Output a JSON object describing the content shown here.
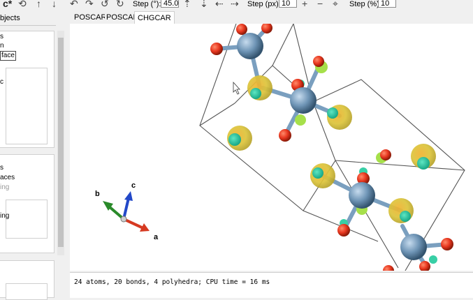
{
  "toolbar": {
    "c_icon": "c*",
    "step_deg_label": "Step (°):",
    "step_deg_value": "45.0",
    "step_px_label": "Step (px):",
    "step_px_value": "10",
    "step_pct_label": "Step (%):",
    "step_pct_value": "10"
  },
  "left_panel": {
    "header": "bjects",
    "items_top": [
      "s",
      "n",
      "face",
      "c"
    ],
    "items_mid": [
      "s",
      "aces",
      "ing"
    ],
    "items_low": [
      "ing"
    ]
  },
  "tabs": [
    "POSCAR",
    "POSCAR",
    "CHGCAR"
  ],
  "active_tab": "CHGCAR",
  "axes": {
    "a": "a",
    "b": "b",
    "c": "c"
  },
  "status": "24 atoms, 20 bonds, 4 polyhedra; CPU time = 16 ms",
  "colors": {
    "oxygen": "#e8371f",
    "metal": "#6f95b6",
    "isosurface_yellow": "#d9c237",
    "isosurface_cyan": "#22c9a0",
    "axis_a": "#d63a22",
    "axis_b": "#2a8a2a",
    "axis_c": "#2248c8"
  }
}
